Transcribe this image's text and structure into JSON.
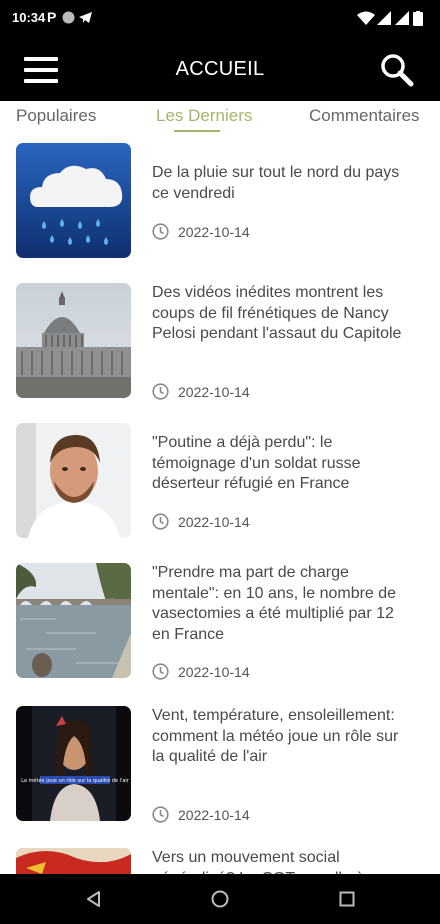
{
  "status_bar": {
    "time": "10:34",
    "notification_letter": "P"
  },
  "app_bar": {
    "title": "ACCUEIL",
    "menu_icon": "hamburger-icon",
    "search_icon": "search-icon"
  },
  "tabs": [
    {
      "label": "Populaires",
      "active": false
    },
    {
      "label": "Les Derniers",
      "active": true
    },
    {
      "label": "Commentaires",
      "active": false
    }
  ],
  "colors": {
    "accent": "#a8b36a",
    "bar_background": "#000000",
    "text": "#4a4a4a"
  },
  "articles": [
    {
      "title": "De la pluie sur tout le nord du pays ce vendredi",
      "date": "2022-10-14",
      "thumb": "rain-cloud-icon"
    },
    {
      "title": "Des vidéos inédites montrent les coups de fil frénétiques de Nancy Pelosi pendant l'assaut du Capitole",
      "date": "2022-10-14",
      "thumb": "capitol-photo"
    },
    {
      "title": "\"Poutine a déjà perdu\": le témoignage d'un soldat russe déserteur réfugié en France",
      "date": "2022-10-14",
      "thumb": "soldier-portrait-photo"
    },
    {
      "title": "\"Prendre ma part de charge mentale\": en 10 ans, le nombre de vasectomies a été multiplié par 12 en France",
      "date": "2022-10-14",
      "thumb": "seine-river-photo"
    },
    {
      "title": "Vent, température, ensoleillement: comment la météo joue un rôle sur la qualité de l'air",
      "date": "2022-10-14",
      "thumb": "weather-presenter-photo",
      "thumb_caption": "La météo joue un rôle sur la qualité de l'air"
    },
    {
      "title": "Vers un mouvement social généralisé? La CGT appelle à",
      "date": "",
      "thumb": "cgt-flags-photo"
    }
  ],
  "nav_bar": {
    "back_icon": "back-triangle-icon",
    "home_icon": "home-circle-icon",
    "recents_icon": "recents-square-icon"
  }
}
